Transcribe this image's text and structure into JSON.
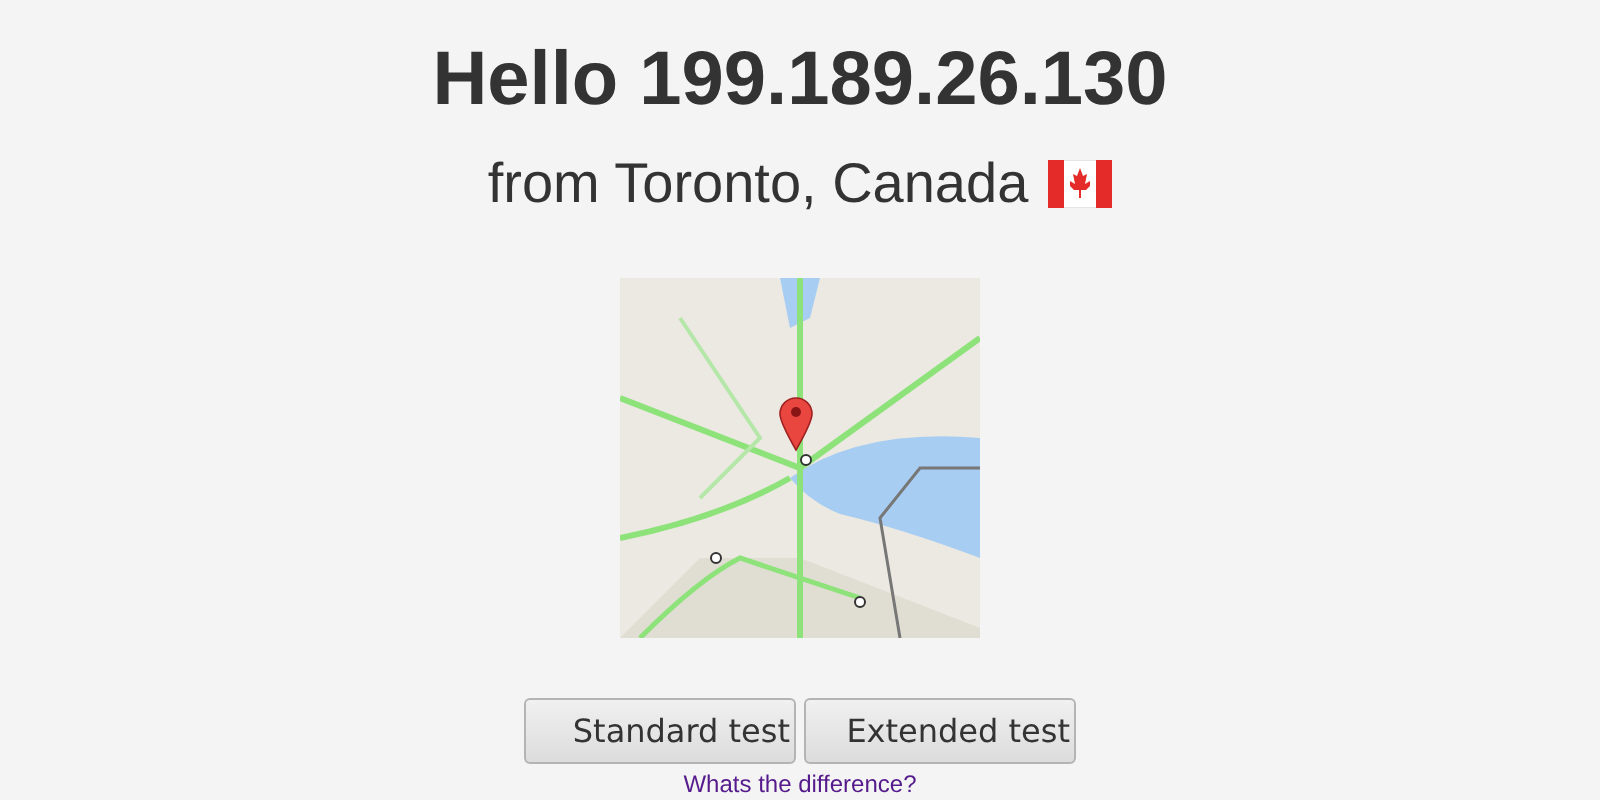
{
  "heading": "Hello 199.189.26.130",
  "location": "from Toronto, Canada",
  "buttons": [
    "Standard test",
    "Extended test"
  ],
  "link": "Whats the difference?"
}
